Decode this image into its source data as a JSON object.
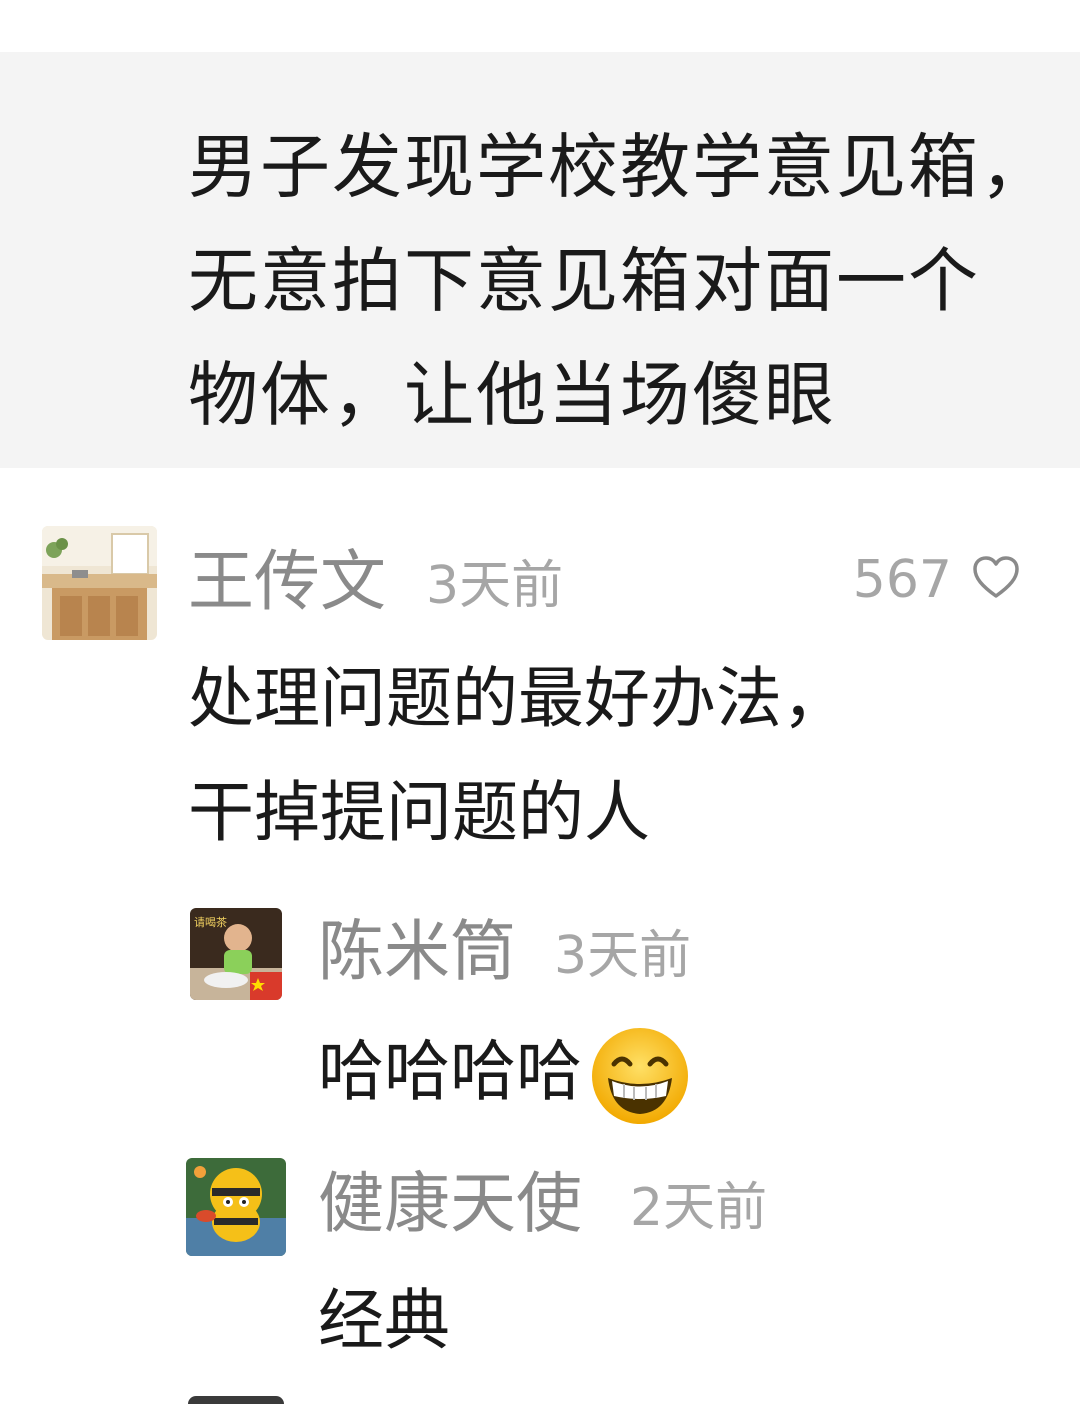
{
  "article": {
    "title_text": "男子发现学校教学意见箱，\n无意拍下意见箱对面一个\n物体，让他当场傻眼"
  },
  "comments": [
    {
      "username": "王传文",
      "time": "3天前",
      "likes": "567",
      "text": "处理问题的最好办法，\n干掉提问题的人",
      "avatar_icon": "kitchen-photo-avatar"
    }
  ],
  "replies": [
    {
      "username": "陈米筒",
      "time": "3天前",
      "text": "哈哈哈哈",
      "emoji": "grinning-face-emoji",
      "avatar_icon": "child-photo-avatar",
      "badge_icon": "china-flag-icon",
      "avatar_caption": "请喝茶"
    },
    {
      "username": "健康天使",
      "time": "2天前",
      "text": "经典",
      "avatar_icon": "bee-character-avatar"
    }
  ],
  "colors": {
    "card_bg": "#f4f4f4",
    "username": "#8a8a8a",
    "meta": "#a6a6a6",
    "text": "#1a1a1a"
  }
}
